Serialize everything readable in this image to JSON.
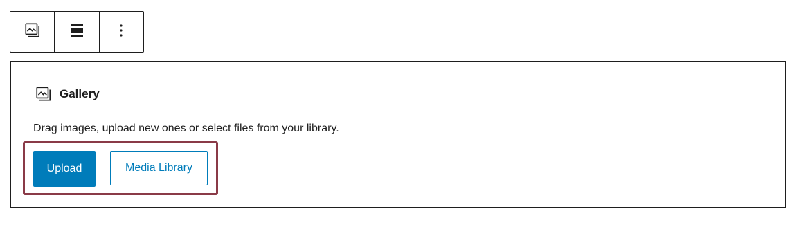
{
  "toolbar": {
    "buttons": [
      {
        "icon": "gallery-icon"
      },
      {
        "icon": "align-icon"
      },
      {
        "icon": "more-options-icon"
      }
    ]
  },
  "block": {
    "title": "Gallery",
    "instructions": "Drag images, upload new ones or select files from your library.",
    "upload_label": "Upload",
    "media_library_label": "Media Library"
  },
  "colors": {
    "accent": "#007cba",
    "highlight": "#8a3a47",
    "border": "#1e1e1e"
  }
}
